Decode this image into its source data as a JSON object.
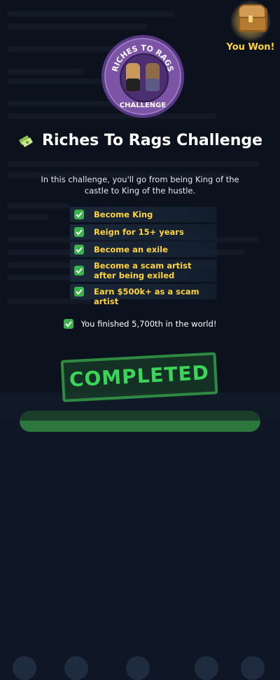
{
  "badge": {
    "top_text": "RICHES TO RAGS",
    "bottom_text": "CHALLENGE"
  },
  "chest": {
    "label": "You Won!"
  },
  "challenge": {
    "title": "Riches To Rags Challenge",
    "description": "In this challenge, you'll go from being King of the castle to King of the hustle.",
    "tasks": [
      {
        "label": "Become King"
      },
      {
        "label": "Reign for 15+ years"
      },
      {
        "label": "Become an exile"
      },
      {
        "label": "Become a scam artist after being exiled"
      },
      {
        "label": "Earn $500k+ as a scam artist"
      }
    ],
    "finish": "You finished 5,700th in the world!",
    "stamp": "COMPLETED"
  },
  "colors": {
    "accent": "#ffd43b",
    "check": "#3ab34a",
    "stamp": "#3bd55a"
  }
}
